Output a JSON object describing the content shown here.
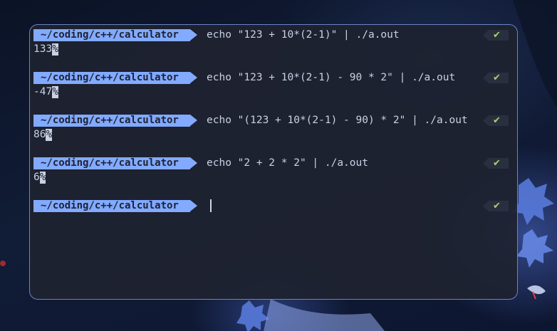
{
  "terminal": {
    "prompt_path": "~/coding/c++/calculator",
    "status_icon": "check-icon",
    "status_glyph": "✔",
    "status_color": "#a6d46a",
    "prompt_color": "#82aaff",
    "eol_marker": "%",
    "entries": [
      {
        "command": "echo \"123 + 10*(2-1)\" | ./a.out",
        "output": "133"
      },
      {
        "command": "echo \"123 + 10*(2-1) - 90 * 2\" | ./a.out",
        "output": "-47"
      },
      {
        "command": "echo \"(123 + 10*(2-1) - 90) * 2\" | ./a.out",
        "output": "86"
      },
      {
        "command": "echo \"2 + 2 * 2\" | ./a.out",
        "output": "6"
      }
    ],
    "current_command": ""
  }
}
